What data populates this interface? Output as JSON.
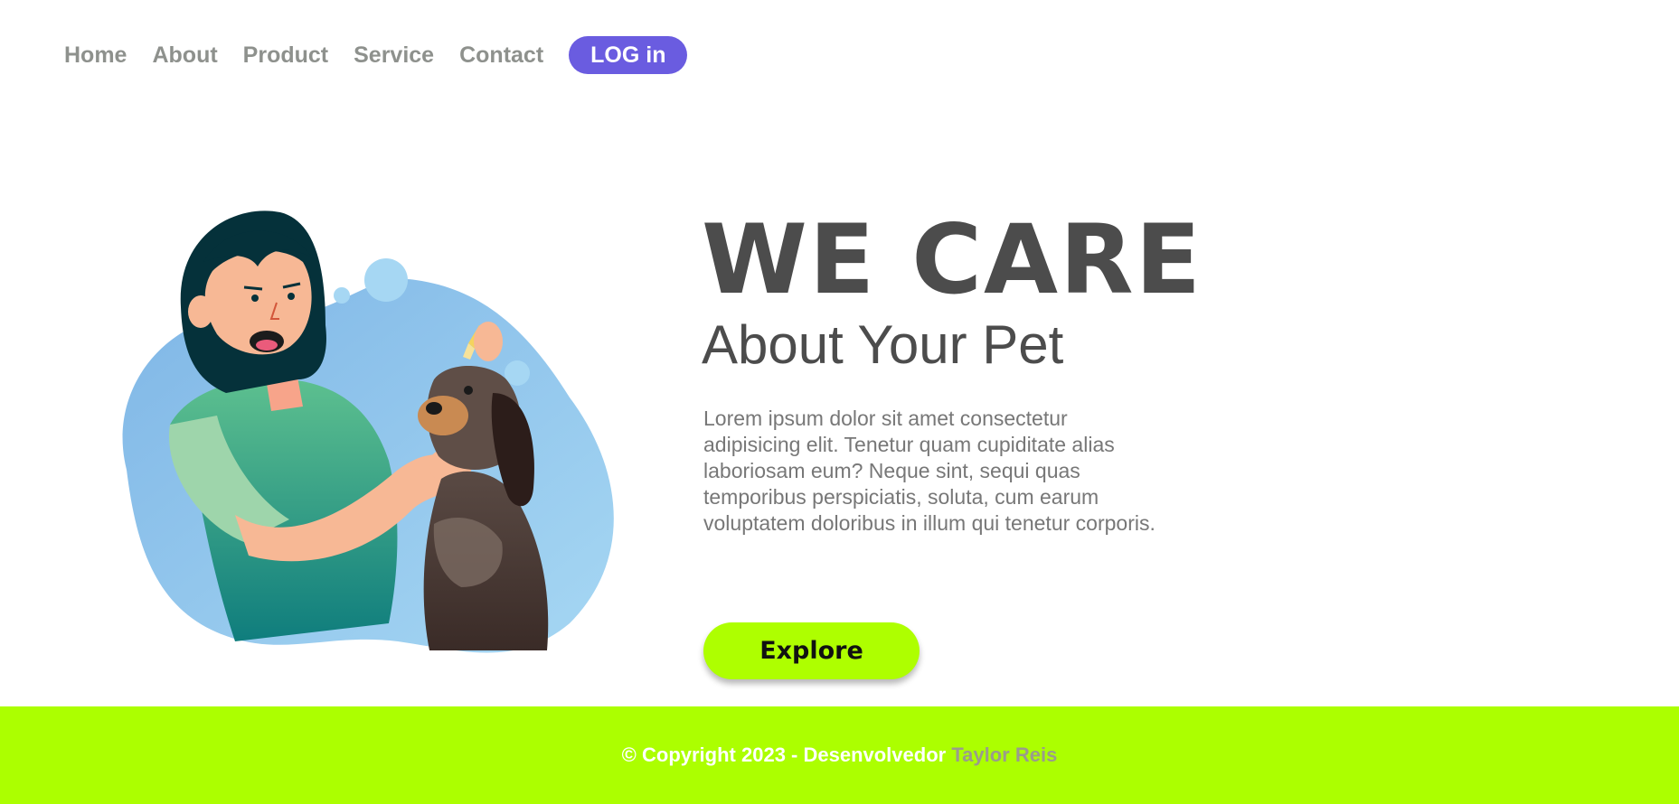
{
  "nav": {
    "items": [
      {
        "label": "Home"
      },
      {
        "label": "About"
      },
      {
        "label": "Product"
      },
      {
        "label": "Service"
      },
      {
        "label": "Contact"
      }
    ],
    "login_label": "LOG in"
  },
  "hero": {
    "title": "WE CARE",
    "subtitle": "About Your Pet",
    "description": "Lorem ipsum dolor sit amet consectetur adipisicing elit. Tenetur quam cupiditate alias laboriosam eum? Neque sint, sequi quas temporibus perspiciatis, soluta, cum earum voluptatem doloribus in illum qui tenetur corporis.",
    "cta_label": "Explore"
  },
  "footer": {
    "text": "© Copyright 2023 - Desenvolvedor",
    "author": "Taylor Reis"
  },
  "colors": {
    "accent": "#6a5ce0",
    "lime": "#aeff00",
    "heading": "#4c4c4c",
    "nav_text": "#8e918d"
  },
  "icons": {
    "illustration": "vet-woman-with-dog-illustration"
  }
}
